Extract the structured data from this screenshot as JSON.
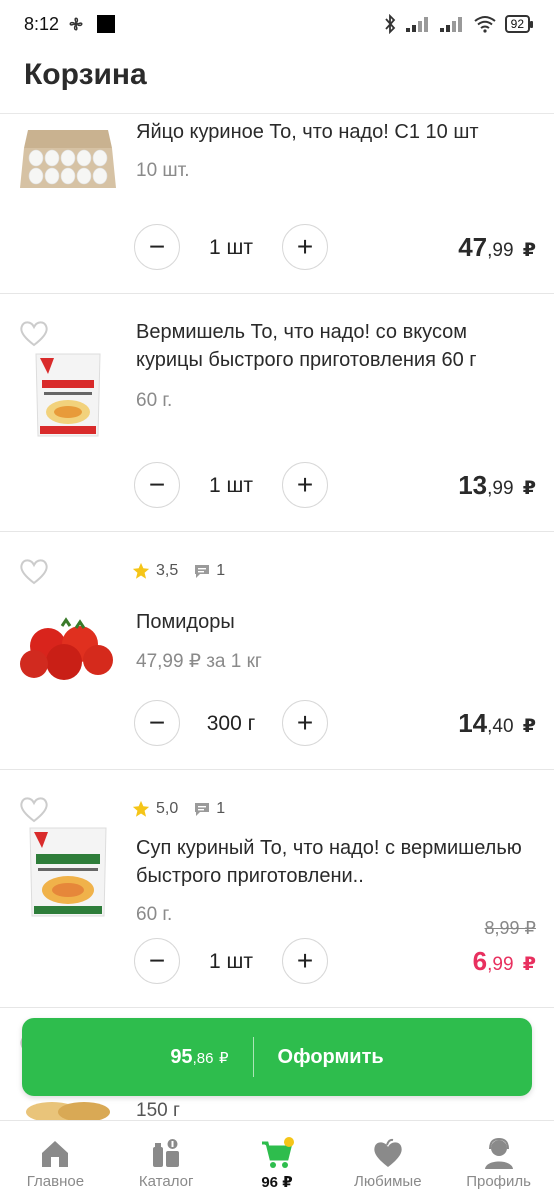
{
  "status_bar": {
    "time": "8:12",
    "battery": "92"
  },
  "header": {
    "title": "Корзина"
  },
  "items": [
    {
      "title": "Яйцо куриное То, что надо! С1 10 шт",
      "subtitle": "10 шт.",
      "quantity": "1 шт",
      "price_int": "47",
      "price_dec": ",99",
      "currency": "₽"
    },
    {
      "title": "Вермишель То, что надо! со вкусом курицы быстрого приготовления 60 г",
      "subtitle": "60 г.",
      "quantity": "1 шт",
      "price_int": "13",
      "price_dec": ",99",
      "currency": "₽"
    },
    {
      "rating": "3,5",
      "reviews": "1",
      "title": "Помидоры",
      "subtitle": "47,99 ₽ за 1 кг",
      "quantity": "300 г",
      "price_int": "14",
      "price_dec": ",40",
      "currency": "₽"
    },
    {
      "rating": "5,0",
      "reviews": "1",
      "title": "Суп куриный То, что надо! с вермишелью быстрого приготовлени..",
      "subtitle": "60 г.",
      "old_price": "8,99 ₽",
      "quantity": "1 шт",
      "price_int": "6",
      "price_dec": ",99",
      "currency": "₽"
    }
  ],
  "peek": {
    "weight": "150 г"
  },
  "checkout": {
    "total_int": "95",
    "total_dec": ",86",
    "currency": "₽",
    "label": "Оформить"
  },
  "tabbar": {
    "tabs": [
      {
        "label": "Главное",
        "icon": "home-icon"
      },
      {
        "label": "Каталог",
        "icon": "catalog-icon"
      },
      {
        "label": "96 ₽",
        "icon": "cart-icon",
        "active": true
      },
      {
        "label": "Любимые",
        "icon": "heart-icon"
      },
      {
        "label": "Профиль",
        "icon": "profile-icon"
      }
    ]
  },
  "colors": {
    "accent_green": "#2ebd4d",
    "sale_pink": "#e8305f",
    "star": "#f5c518",
    "badge_yellow": "#f5c518"
  }
}
